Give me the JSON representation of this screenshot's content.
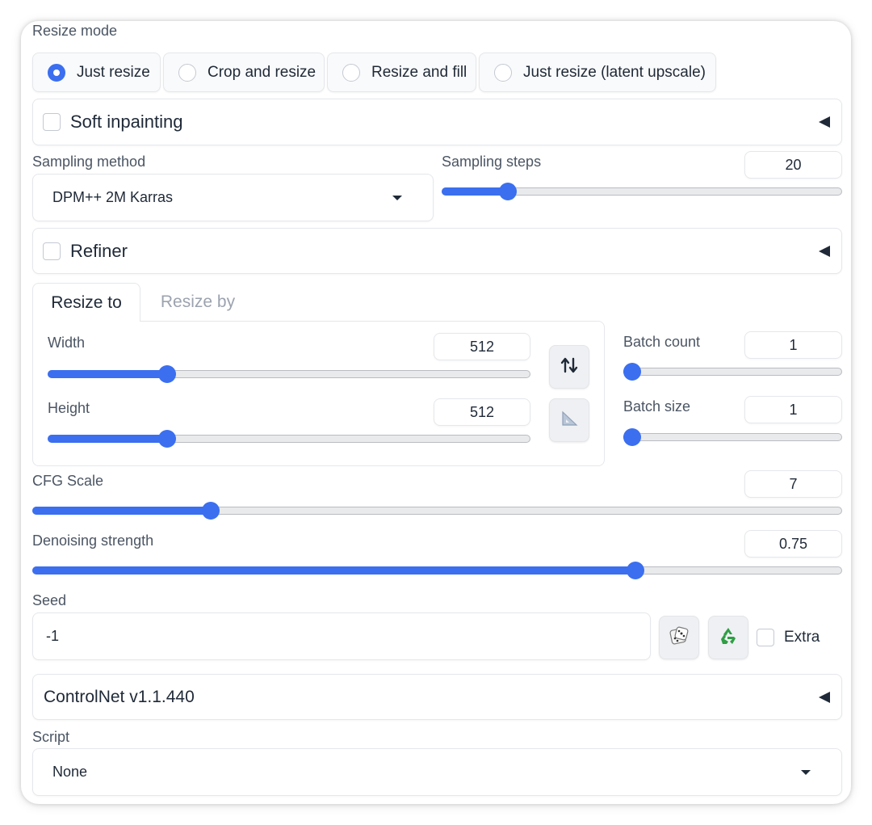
{
  "resize_mode": {
    "label": "Resize mode",
    "options": [
      "Just resize",
      "Crop and resize",
      "Resize and fill",
      "Just resize (latent upscale)"
    ],
    "selected": "Just resize"
  },
  "soft_inpainting": {
    "label": "Soft inpainting",
    "checked": false
  },
  "sampling_method": {
    "label": "Sampling method",
    "value": "DPM++ 2M Karras"
  },
  "sampling_steps": {
    "label": "Sampling steps",
    "value": "20",
    "fraction": 0.15
  },
  "refiner": {
    "label": "Refiner",
    "checked": false
  },
  "size_tabs": {
    "active": "Resize to",
    "inactive": "Resize by"
  },
  "width": {
    "label": "Width",
    "value": "512",
    "fraction": 0.237
  },
  "height": {
    "label": "Height",
    "value": "512",
    "fraction": 0.237
  },
  "batch_count": {
    "label": "Batch count",
    "value": "1",
    "fraction": 0.0
  },
  "batch_size": {
    "label": "Batch size",
    "value": "1",
    "fraction": 0.0
  },
  "cfg_scale": {
    "label": "CFG Scale",
    "value": "7",
    "fraction": 0.214
  },
  "denoising": {
    "label": "Denoising strength",
    "value": "0.75",
    "fraction": 0.75
  },
  "seed": {
    "label": "Seed",
    "value": "-1",
    "extra_label": "Extra",
    "extra_checked": false
  },
  "controlnet": {
    "label": "ControlNet v1.1.440"
  },
  "script": {
    "label": "Script",
    "value": "None"
  },
  "colors": {
    "accent": "#3b6ff0",
    "track": "#e9eaec",
    "border": "#e5e7eb"
  },
  "icons": {
    "swap": "swap-dimensions-icon",
    "ratio": "aspect-ratio-triangle-icon",
    "dice": "dice-icon",
    "recycle": "recycle-icon"
  }
}
